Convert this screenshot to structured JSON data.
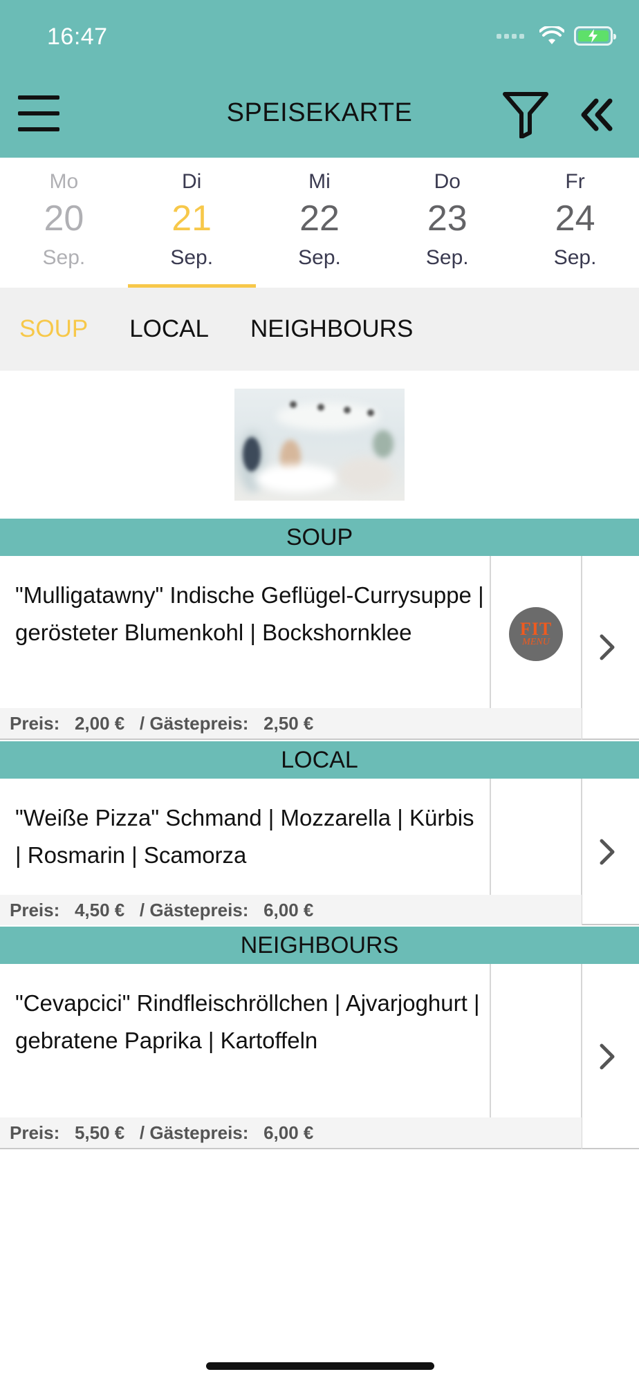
{
  "status_bar": {
    "time": "16:47"
  },
  "header": {
    "title": "SPEISEKARTE"
  },
  "dates": [
    {
      "weekday": "Mo",
      "day": "20",
      "month": "Sep.",
      "state": "past"
    },
    {
      "weekday": "Di",
      "day": "21",
      "month": "Sep.",
      "state": "active"
    },
    {
      "weekday": "Mi",
      "day": "22",
      "month": "Sep.",
      "state": "normal"
    },
    {
      "weekday": "Do",
      "day": "23",
      "month": "Sep.",
      "state": "normal"
    },
    {
      "weekday": "Fr",
      "day": "24",
      "month": "Sep.",
      "state": "normal"
    }
  ],
  "categories": [
    {
      "label": "SOUP",
      "active": true
    },
    {
      "label": "LOCAL",
      "active": false
    },
    {
      "label": "NEIGHBOURS",
      "active": false
    }
  ],
  "sections": [
    {
      "title": "SOUP",
      "item": {
        "name": "\"Mulligatawny\" Indische Geflügel-Currysuppe | gerösteter Blumenkohl | Bockshornklee",
        "price_label": "Preis:",
        "price": "2,00 €",
        "guest_label": "/ Gästepreis:",
        "guest_price": "2,50 €",
        "badge": {
          "top": "FIT",
          "bottom": "MENU"
        }
      }
    },
    {
      "title": "LOCAL",
      "item": {
        "name": "\"Weiße Pizza\" Schmand | Mozzarella | Kürbis | Rosmarin | Scamorza",
        "price_label": "Preis:",
        "price": "4,50 €",
        "guest_label": "/ Gästepreis:",
        "guest_price": "6,00 €"
      }
    },
    {
      "title": "NEIGHBOURS",
      "item": {
        "name": "\"Cevapcici\" Rindfleischröllchen | Ajvarjoghurt | gebratene Paprika | Kartoffeln",
        "price_label": "Preis:",
        "price": "5,50 €",
        "guest_label": "/ Gästepreis:",
        "guest_price": "6,00 €"
      }
    }
  ],
  "colors": {
    "accent": "#6bbcb6",
    "highlight": "#f7c84a",
    "badge_bg": "#6b6b6b",
    "badge_text": "#f05a1e"
  },
  "icons": [
    "menu-icon",
    "filter-icon",
    "collapse-icon",
    "chevron-right-icon",
    "wifi-icon",
    "battery-icon"
  ]
}
